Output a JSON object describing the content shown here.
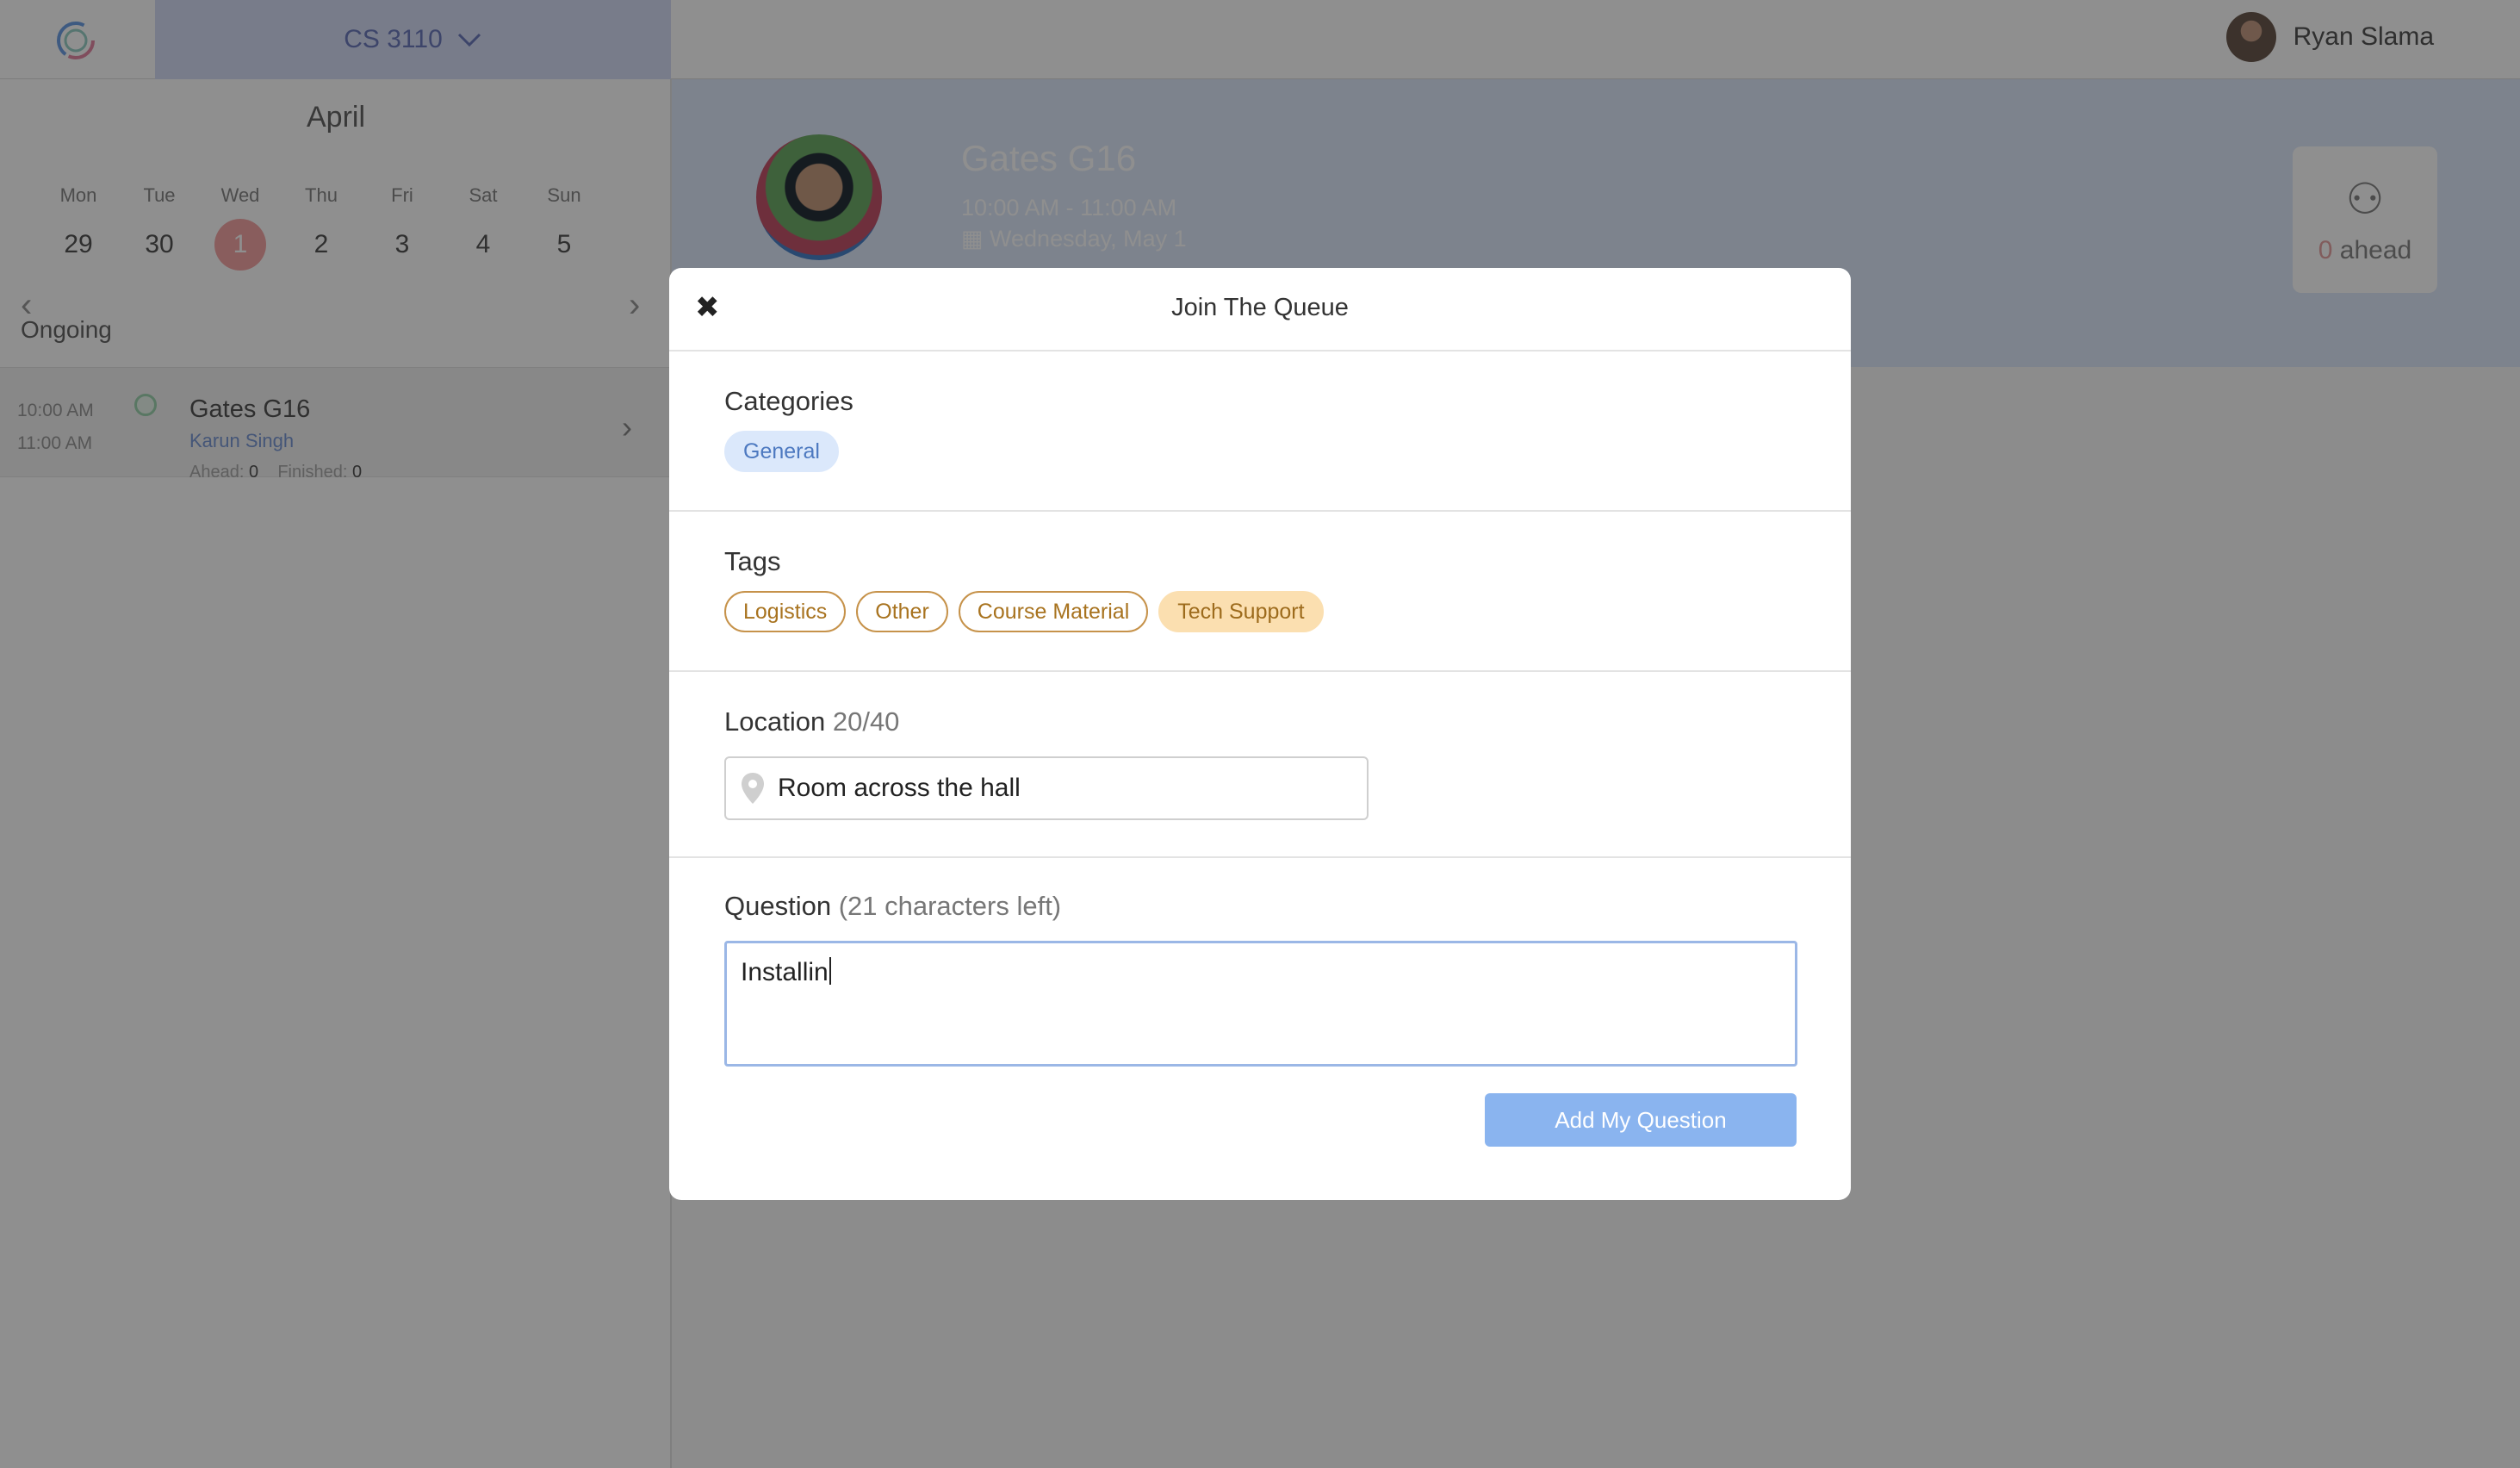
{
  "header": {
    "course": "CS 3110",
    "user_name": "Ryan Slama"
  },
  "sidebar": {
    "month": "April",
    "days": [
      {
        "name": "Mon",
        "date": "29"
      },
      {
        "name": "Tue",
        "date": "30"
      },
      {
        "name": "Wed",
        "date": "1",
        "selected": true
      },
      {
        "name": "Thu",
        "date": "2"
      },
      {
        "name": "Fri",
        "date": "3"
      },
      {
        "name": "Sat",
        "date": "4"
      },
      {
        "name": "Sun",
        "date": "5"
      }
    ],
    "section_label": "Ongoing",
    "session": {
      "start": "10:00 AM",
      "end": "11:00 AM",
      "room": "Gates G16",
      "ta": "Karun Singh",
      "ahead_label": "Ahead:",
      "ahead_count": "0",
      "finished_label": "Finished:",
      "finished_count": "0"
    }
  },
  "banner": {
    "room": "Gates G16",
    "time": "10:00 AM - 11:00 AM",
    "date": "Wednesday, May 1",
    "ahead_count": "0",
    "ahead_label": "ahead"
  },
  "modal": {
    "close_icon": "✖",
    "title": "Join The Queue",
    "categories_label": "Categories",
    "categories": [
      "General"
    ],
    "tags_label": "Tags",
    "tags": [
      {
        "label": "Logistics",
        "selected": false
      },
      {
        "label": "Other",
        "selected": false
      },
      {
        "label": "Course Material",
        "selected": false
      },
      {
        "label": "Tech Support",
        "selected": true
      }
    ],
    "location_label": "Location",
    "location_count": "20/40",
    "location_value": "Room across the hall",
    "question_label": "Question",
    "question_hint": "(21 characters left)",
    "question_value": "Installin",
    "submit_label": "Add My Question"
  },
  "colors": {
    "accent": "#8ab4ef",
    "tag_selected": "#fbdfb0",
    "category": "#dbe8fb",
    "selected_day": "#f4a6a6"
  }
}
